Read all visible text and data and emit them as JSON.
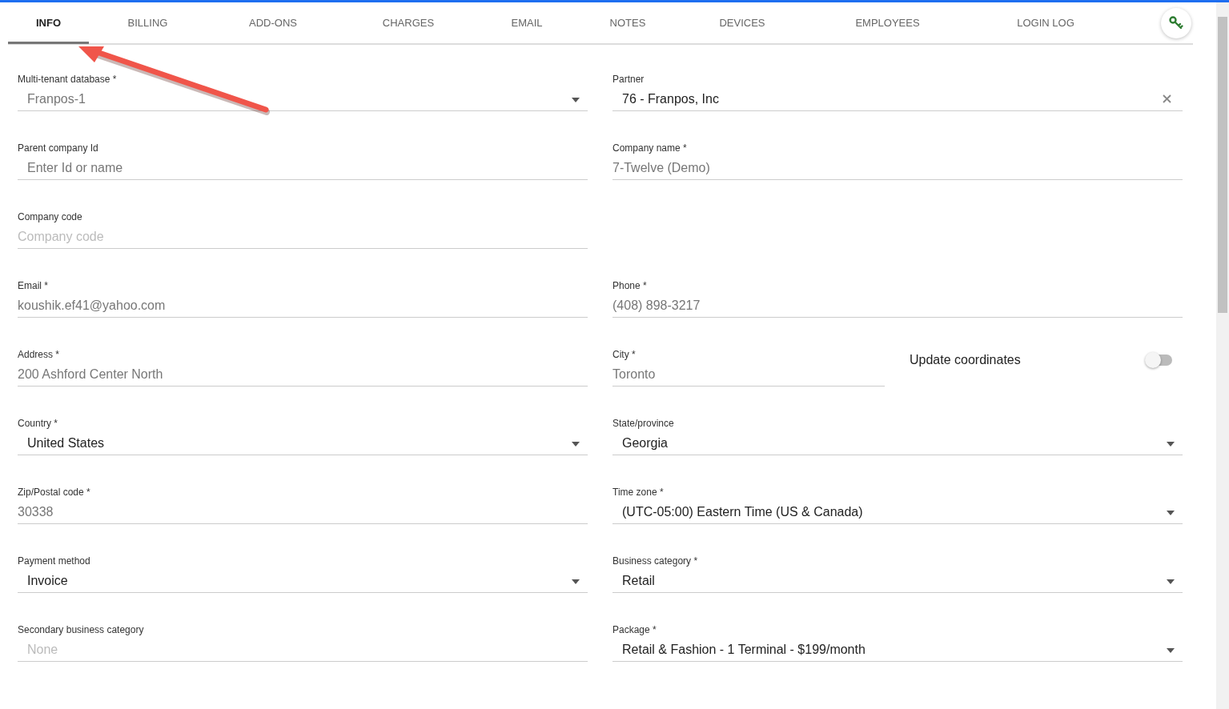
{
  "tabs": [
    {
      "label": "INFO",
      "selected": true
    },
    {
      "label": "BILLING",
      "selected": false
    },
    {
      "label": "ADD-ONS",
      "selected": false
    },
    {
      "label": "CHARGES",
      "selected": false
    },
    {
      "label": "EMAIL",
      "selected": false
    },
    {
      "label": "NOTES",
      "selected": false
    },
    {
      "label": "DEVICES",
      "selected": false
    },
    {
      "label": "EMPLOYEES",
      "selected": false
    },
    {
      "label": "LOGIN LOG",
      "selected": false
    }
  ],
  "rows": [
    [
      {
        "kind": "select",
        "label": "Multi-tenant database *",
        "value": "Franpos-1",
        "disabled": true
      },
      {
        "kind": "autocomplete",
        "label": "Partner",
        "value": "76 - Franpos, Inc",
        "clearable": true
      }
    ],
    [
      {
        "kind": "autocomplete",
        "label": "Parent company Id",
        "value": "Enter Id or name",
        "disabled": true
      },
      {
        "kind": "text",
        "label": "Company name *",
        "value": "7-Twelve (Demo)"
      }
    ],
    [
      {
        "kind": "text",
        "label": "Company code",
        "placeholder": "Company code"
      }
    ],
    [
      {
        "kind": "text",
        "label": "Email *",
        "value": "koushik.ef41@yahoo.com"
      },
      {
        "kind": "text",
        "label": "Phone *",
        "value": "(408) 898-3217"
      }
    ],
    [
      {
        "kind": "text",
        "label": "Address *",
        "value": "200 Ashford Center North"
      },
      {
        "kind": "text",
        "label": "City *",
        "value": "Toronto"
      },
      {
        "kind": "toggle",
        "label": "Update coordinates",
        "on": false
      }
    ],
    [
      {
        "kind": "select",
        "label": "Country *",
        "value": "United States"
      },
      {
        "kind": "select",
        "label": "State/province",
        "value": "Georgia"
      }
    ],
    [
      {
        "kind": "text",
        "label": "Zip/Postal code *",
        "value": "30338"
      },
      {
        "kind": "select",
        "label": "Time zone *",
        "value": "(UTC-05:00) Eastern Time (US & Canada)"
      }
    ],
    [
      {
        "kind": "select",
        "label": "Payment method",
        "value": "Invoice"
      },
      {
        "kind": "select",
        "label": "Business category *",
        "value": "Retail"
      }
    ],
    [
      {
        "kind": "autocomplete",
        "label": "Secondary business category",
        "placeholder": "None"
      },
      {
        "kind": "select",
        "label": "Package *",
        "value": "Retail & Fashion - 1 Terminal - $199/month"
      }
    ]
  ]
}
